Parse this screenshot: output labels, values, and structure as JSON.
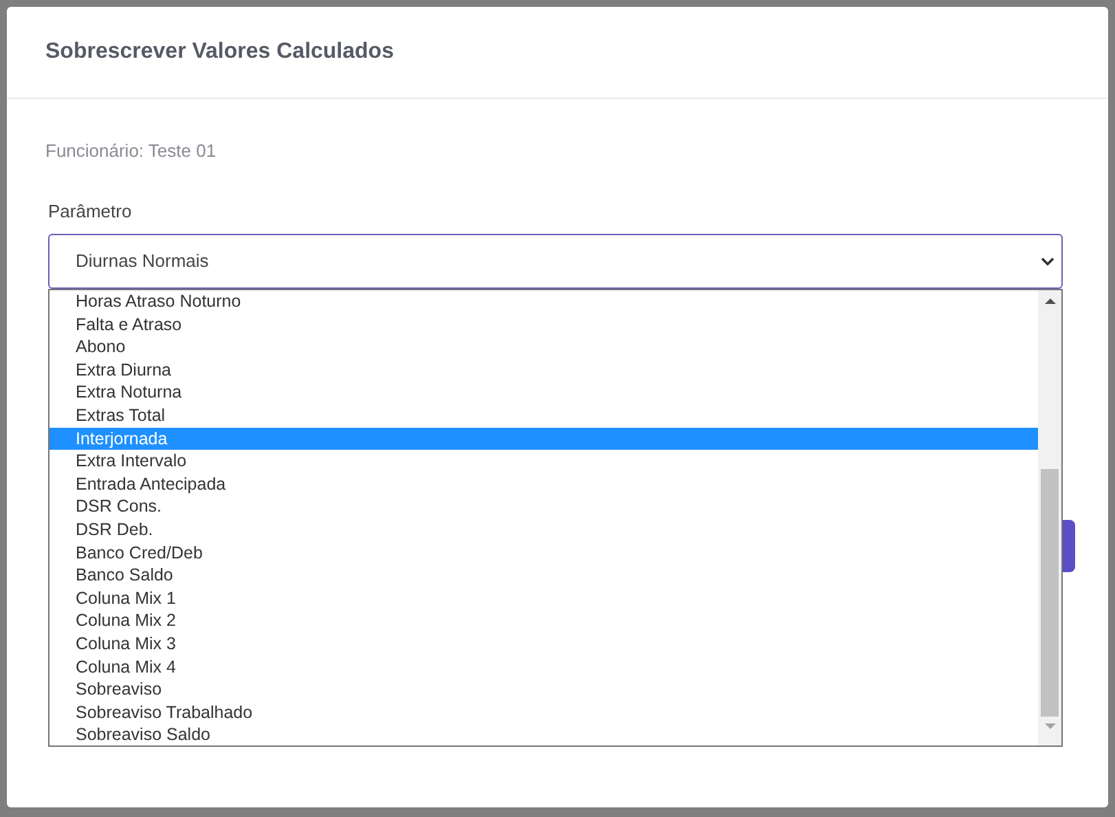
{
  "modal": {
    "title": "Sobrescrever Valores Calculados"
  },
  "employee": "Funcionário: Teste 01",
  "parameter": {
    "label": "Parâmetro",
    "value": "Diurnas Normais",
    "options": [
      {
        "label": "Horas Atraso Noturno",
        "selected": false
      },
      {
        "label": "Falta e Atraso",
        "selected": false
      },
      {
        "label": "Abono",
        "selected": false
      },
      {
        "label": "Extra Diurna",
        "selected": false
      },
      {
        "label": "Extra Noturna",
        "selected": false
      },
      {
        "label": "Extras Total",
        "selected": false
      },
      {
        "label": "Interjornada",
        "selected": true
      },
      {
        "label": "Extra Intervalo",
        "selected": false
      },
      {
        "label": "Entrada Antecipada",
        "selected": false
      },
      {
        "label": "DSR Cons.",
        "selected": false
      },
      {
        "label": "DSR Deb.",
        "selected": false
      },
      {
        "label": "Banco Cred/Deb",
        "selected": false
      },
      {
        "label": "Banco Saldo",
        "selected": false
      },
      {
        "label": "Coluna Mix 1",
        "selected": false
      },
      {
        "label": "Coluna Mix 2",
        "selected": false
      },
      {
        "label": "Coluna Mix 3",
        "selected": false
      },
      {
        "label": "Coluna Mix 4",
        "selected": false
      },
      {
        "label": "Sobreaviso",
        "selected": false
      },
      {
        "label": "Sobreaviso Trabalhado",
        "selected": false
      },
      {
        "label": "Sobreaviso Saldo",
        "selected": false
      }
    ]
  }
}
